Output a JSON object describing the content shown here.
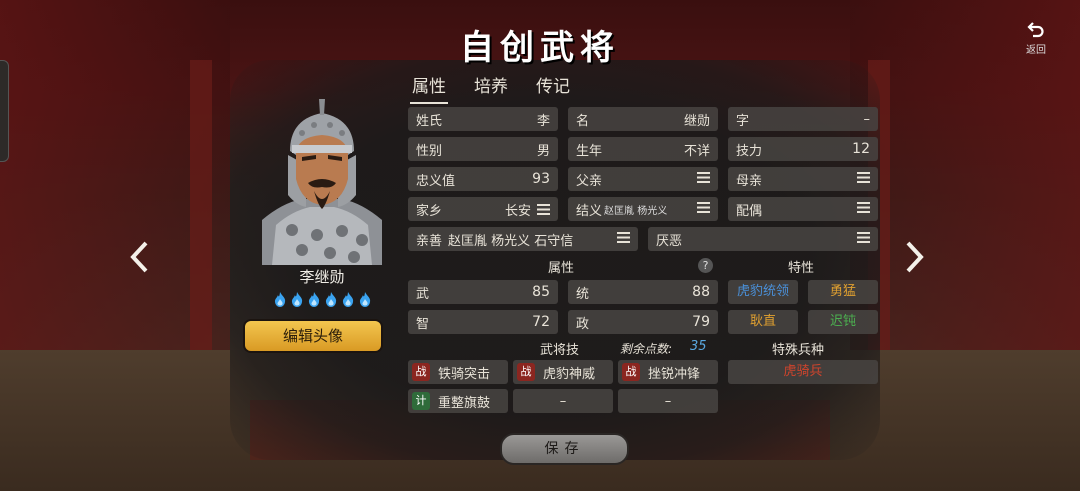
{
  "title": "自创武将",
  "back": {
    "label": "返回"
  },
  "tabs": [
    "属性",
    "培养",
    "传记"
  ],
  "character": {
    "name": "李继勋",
    "edit_avatar": "编辑头像",
    "flame_count": 6
  },
  "fields": {
    "surname": {
      "k": "姓氏",
      "v": "李"
    },
    "given": {
      "k": "名",
      "v": "继勋"
    },
    "courtesy": {
      "k": "字",
      "v": "–"
    },
    "gender": {
      "k": "性别",
      "v": "男"
    },
    "birth": {
      "k": "生年",
      "v": "不详"
    },
    "skill_power": {
      "k": "技力",
      "v": "12"
    },
    "loyalty": {
      "k": "忠义值",
      "v": "93"
    },
    "father": {
      "k": "父亲"
    },
    "mother": {
      "k": "母亲"
    },
    "hometown": {
      "k": "家乡",
      "v": "长安"
    },
    "sworn": {
      "k": "结义",
      "v": "赵匡胤 杨光义"
    },
    "spouse": {
      "k": "配偶"
    },
    "likes": {
      "k": "亲善",
      "v": "赵匡胤 杨光义 石守信"
    },
    "dislikes": {
      "k": "厌恶"
    }
  },
  "attributes": {
    "header": "属性",
    "help": "?",
    "wu": {
      "k": "武",
      "v": "85"
    },
    "tong": {
      "k": "统",
      "v": "88"
    },
    "zhi": {
      "k": "智",
      "v": "72"
    },
    "zheng": {
      "k": "政",
      "v": "79"
    }
  },
  "traits": {
    "header": "特性",
    "items": [
      {
        "label": "虎豹统领",
        "color": "#4a90d9"
      },
      {
        "label": "勇猛",
        "color": "#e0a030"
      },
      {
        "label": "耿直",
        "color": "#e0a030"
      },
      {
        "label": "迟钝",
        "color": "#4caf50"
      }
    ]
  },
  "skills": {
    "header": "武将技",
    "remaining_label": "剩余点数:",
    "remaining_value": "35",
    "items": [
      {
        "tag": "战",
        "label": "铁骑突击"
      },
      {
        "tag": "战",
        "label": "虎豹神威"
      },
      {
        "tag": "战",
        "label": "挫锐冲锋"
      },
      {
        "tag": "计",
        "label": "重整旗鼓"
      },
      {
        "tag": "",
        "label": "–"
      },
      {
        "tag": "",
        "label": "–"
      }
    ]
  },
  "special_unit": {
    "header": "特殊兵种",
    "value": "虎骑兵",
    "color": "#d0442c"
  },
  "save": "保存",
  "colors": {
    "zhan_tag": "#8b2620",
    "ji_tag": "#2f6b3a",
    "accent": "#f0be44"
  }
}
